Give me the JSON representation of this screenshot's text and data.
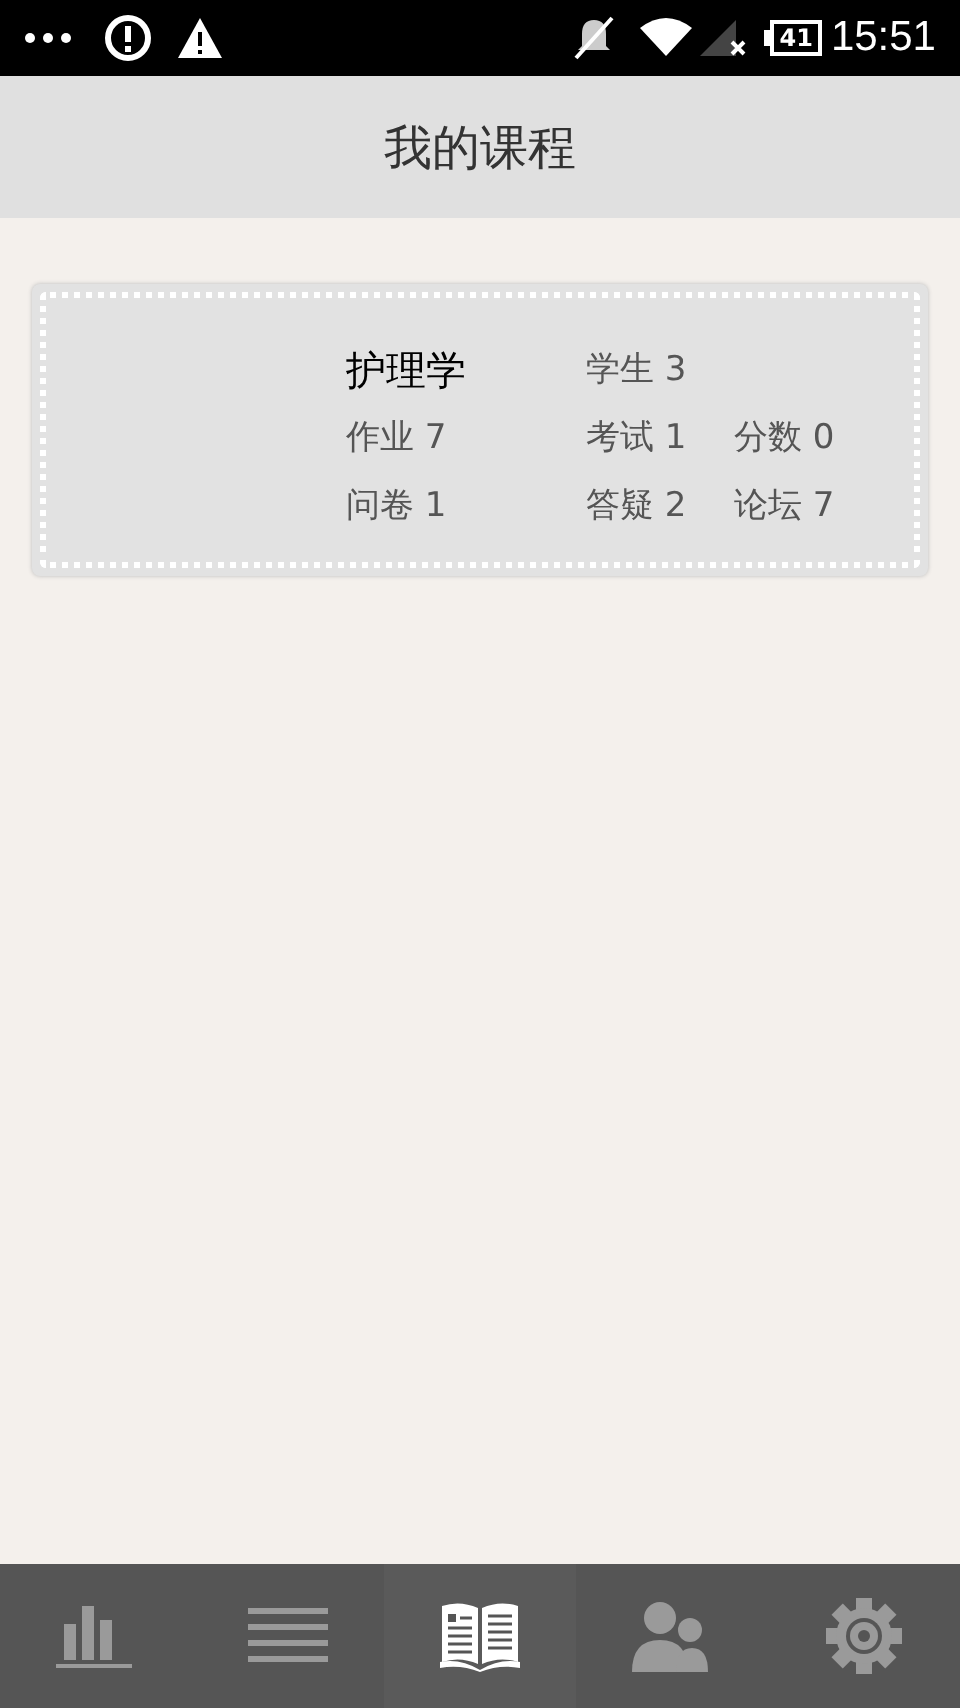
{
  "status_bar": {
    "battery": "41",
    "time": "15:51"
  },
  "header": {
    "title": "我的课程"
  },
  "courses": [
    {
      "name": "护理学",
      "stats": [
        "学生 3",
        "作业 7",
        "考试 1",
        "分数 0",
        "问卷 1",
        "答疑 2",
        "论坛 7"
      ]
    }
  ],
  "nav": [
    {
      "kind": "chart",
      "selected": false
    },
    {
      "kind": "list",
      "selected": false
    },
    {
      "kind": "book",
      "selected": true
    },
    {
      "kind": "people",
      "selected": false
    },
    {
      "kind": "gear",
      "selected": false
    }
  ]
}
